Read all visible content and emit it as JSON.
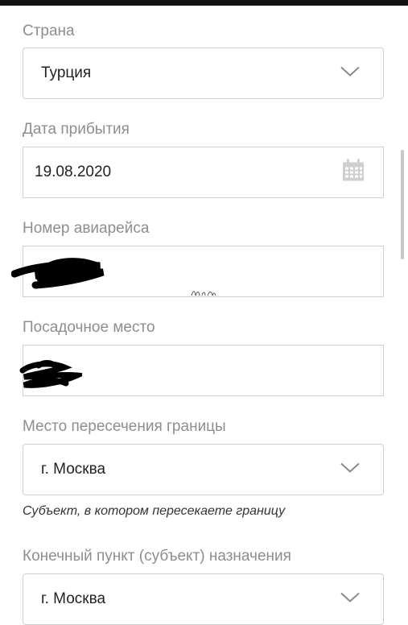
{
  "form": {
    "country": {
      "label": "Страна",
      "value": "Турция",
      "icon": "chevron-down-icon"
    },
    "arrival_date": {
      "label": "Дата прибытия",
      "value": "19.08.2020",
      "icon": "calendar-icon"
    },
    "flight_number": {
      "label": "Номер авиарейса",
      "value": ""
    },
    "seat": {
      "label": "Посадочное место",
      "value": ""
    },
    "border_crossing": {
      "label": "Место пересечения границы",
      "value": "г. Москва",
      "hint": "Субъект, в котором пересекаете границу",
      "icon": "chevron-down-icon"
    },
    "destination": {
      "label": "Конечный пункт (субъект) назначения",
      "value": "г. Москва",
      "icon": "chevron-down-icon"
    }
  },
  "colors": {
    "label": "#8e8e8e",
    "border": "#cfcfcf",
    "chevron": "#8a8a8a",
    "text": "#222222"
  }
}
